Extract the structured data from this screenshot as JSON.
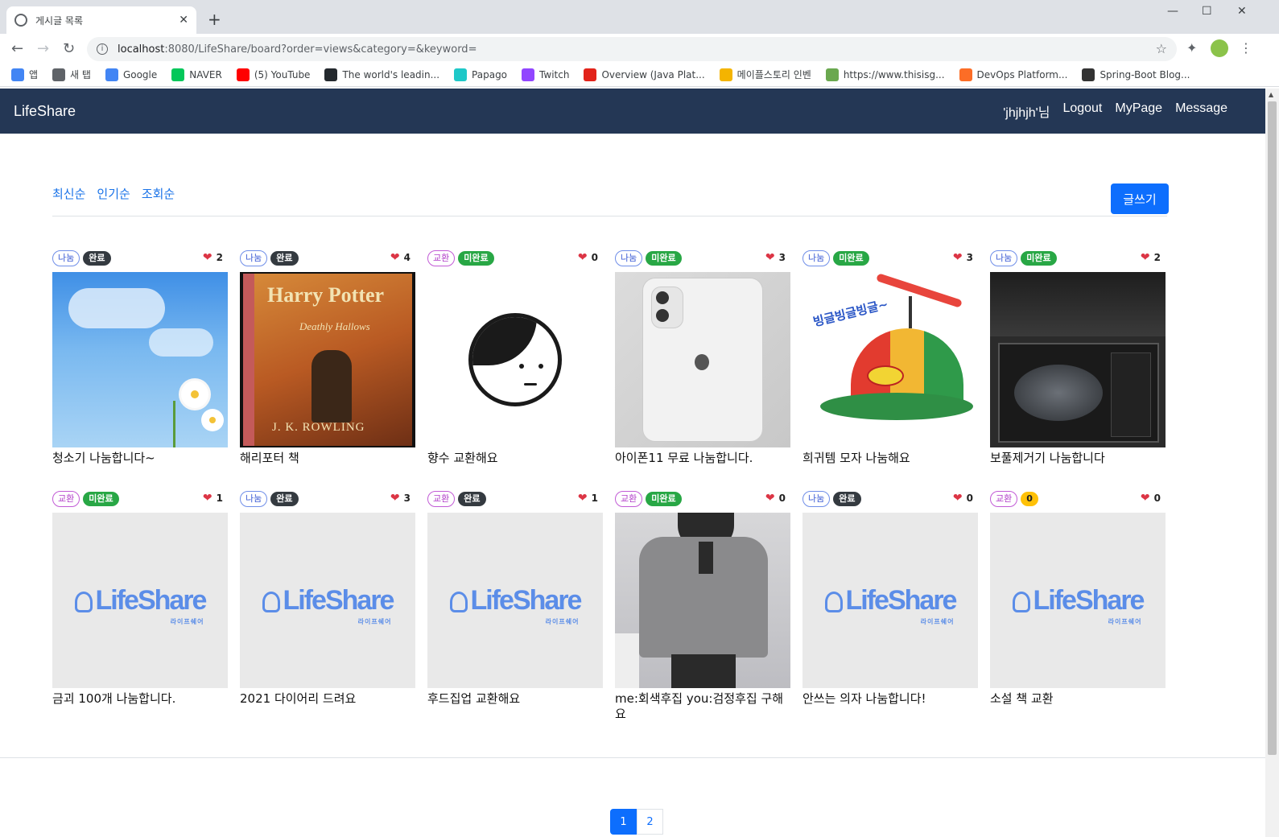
{
  "browser": {
    "tab_title": "게시글 목록",
    "url_host": "localhost",
    "url_rest": ":8080/LifeShare/board?order=views&category=&keyword=",
    "bookmarks": [
      {
        "label": "앱",
        "color": "#4285f4"
      },
      {
        "label": "새 탭",
        "color": "#5f6368"
      },
      {
        "label": "Google",
        "color": "#4285f4"
      },
      {
        "label": "NAVER",
        "color": "#03c75a"
      },
      {
        "label": "(5) YouTube",
        "color": "#ff0000"
      },
      {
        "label": "The world's leadin...",
        "color": "#24292e"
      },
      {
        "label": "Papago",
        "color": "#1ec8c8"
      },
      {
        "label": "Twitch",
        "color": "#9146ff"
      },
      {
        "label": "Overview (Java Plat...",
        "color": "#e2231a"
      },
      {
        "label": "메이플스토리 인벤",
        "color": "#f4b400"
      },
      {
        "label": "https://www.thisisg...",
        "color": "#6aa84f"
      },
      {
        "label": "DevOps Platform...",
        "color": "#fc6d26"
      },
      {
        "label": "Spring-Boot Blog...",
        "color": "#333333"
      }
    ]
  },
  "navbar": {
    "brand": "LifeShare",
    "user": "'jhjhjh'님",
    "logout": "Logout",
    "mypage": "MyPage",
    "message": "Message"
  },
  "sort": {
    "latest": "최신순",
    "popular": "인기순",
    "views": "조회순"
  },
  "write_button": "글쓰기",
  "cards": [
    {
      "category": "나눔",
      "status": "완료",
      "likes": "2",
      "title": "청소기 나눔합니다~",
      "image": "sky-flowers"
    },
    {
      "category": "나눔",
      "status": "완료",
      "likes": "4",
      "title": "해리포터 책",
      "image": "harry-potter-book"
    },
    {
      "category": "교환",
      "status": "미완료",
      "likes": "0",
      "title": "향수 교환해요",
      "image": "face-illustration"
    },
    {
      "category": "나눔",
      "status": "미완료",
      "likes": "3",
      "title": "아이폰11 무료 나눔합니다.",
      "image": "iphone-box"
    },
    {
      "category": "나눔",
      "status": "미완료",
      "likes": "3",
      "title": "희귀템 모자 나눔해요",
      "image": "propeller-cap"
    },
    {
      "category": "나눔",
      "status": "미완료",
      "likes": "2",
      "title": "보풀제거기 나눔합니다",
      "image": "lint-remover-box"
    },
    {
      "category": "교환",
      "status": "미완료",
      "likes": "1",
      "title": "금괴 100개 나눔합니다.",
      "image": "lifeshare-logo"
    },
    {
      "category": "나눔",
      "status": "완료",
      "likes": "3",
      "title": "2021 다이어리 드려요",
      "image": "lifeshare-logo"
    },
    {
      "category": "교환",
      "status": "완료",
      "likes": "1",
      "title": "후드집업 교환해요",
      "image": "lifeshare-logo"
    },
    {
      "category": "교환",
      "status": "미완료",
      "likes": "0",
      "title": "me:회색후집 you:검정후집 구해요",
      "image": "hoodie-photo"
    },
    {
      "category": "나눔",
      "status": "완료",
      "likes": "0",
      "title": "안쓰는 의자 나눔합니다!",
      "image": "lifeshare-logo"
    },
    {
      "category": "교환",
      "status": "0",
      "likes": "0",
      "title": "소설 책 교환",
      "image": "lifeshare-logo"
    }
  ],
  "logo_text": "LifeShare",
  "logo_sub": "라이프쉐어",
  "pagination": [
    "1",
    "2"
  ]
}
